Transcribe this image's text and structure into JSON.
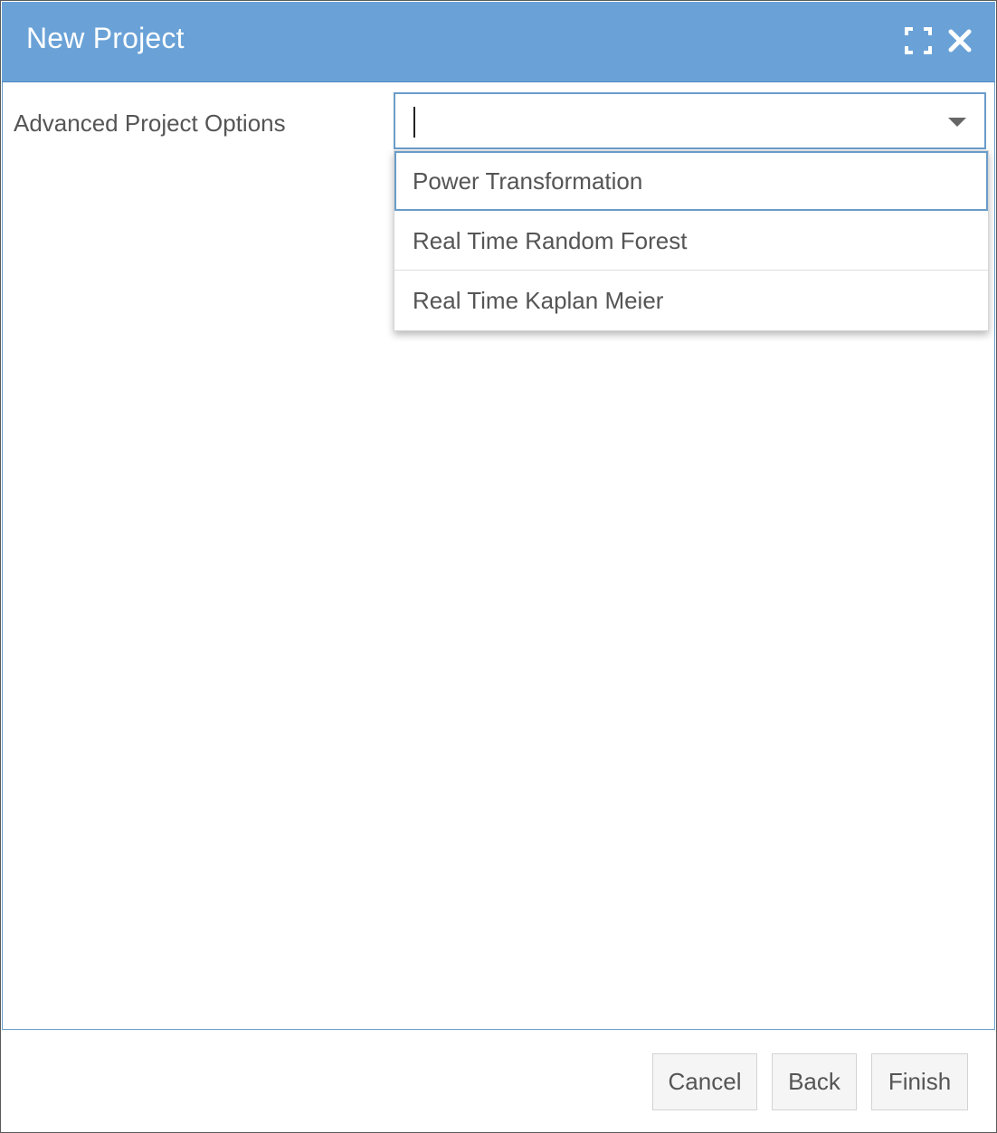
{
  "dialog": {
    "title": "New Project",
    "maximize_icon": "maximize-icon",
    "close_icon": "close-icon",
    "header_color": "#6aa2d7"
  },
  "form": {
    "advanced_options_label": "Advanced Project Options",
    "combo": {
      "value": "",
      "placeholder": "",
      "options": [
        "Power Transformation",
        "Real Time Random Forest",
        "Real Time Kaplan Meier"
      ],
      "focused_option_index": 0
    }
  },
  "footer": {
    "cancel_label": "Cancel",
    "back_label": "Back",
    "finish_label": "Finish"
  }
}
